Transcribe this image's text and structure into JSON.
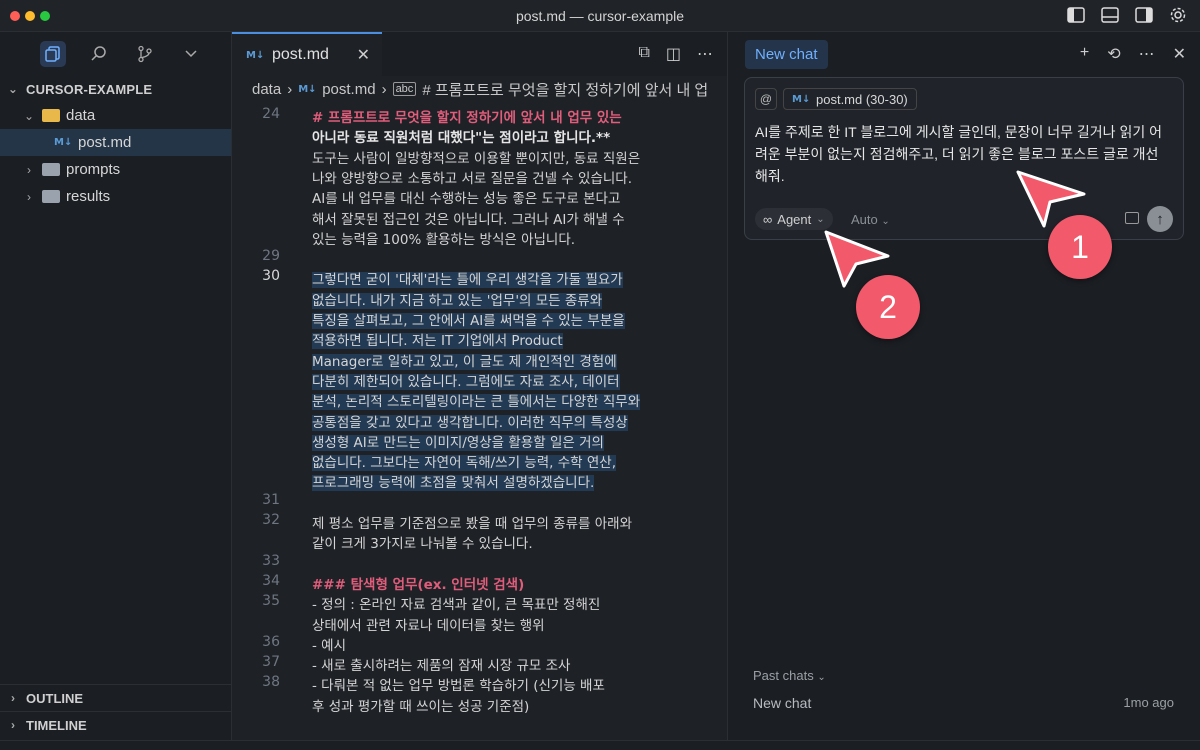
{
  "window": {
    "title": "post.md — cursor-example"
  },
  "colors": {
    "accent": "#4a8fe0",
    "heading": "#e05d7b",
    "callout": "#f25a6b",
    "selection": "#233a55"
  },
  "explorer": {
    "root": "CURSOR-EXAMPLE",
    "items": [
      {
        "label": "data",
        "type": "folder-open"
      },
      {
        "label": "post.md",
        "type": "markdown-file"
      },
      {
        "label": "prompts",
        "type": "folder"
      },
      {
        "label": "results",
        "type": "folder"
      }
    ],
    "outline": "OUTLINE",
    "timeline": "TIMELINE"
  },
  "editor": {
    "tab_label": "post.md",
    "breadcrumb": {
      "folder": "data",
      "file": "post.md",
      "symbol": "# 프롬프트로 무엇을 할지 정하기에 앞서 내 업"
    },
    "lines": [
      {
        "num": "24",
        "text": "# 프롬프트로 무엇을 할지 정하기에 앞서 내 업무 있는",
        "style": "heading"
      },
      {
        "num": "",
        "text": "아니라 동료 직원처럼 대했다\"는 점이라고 합니다.**",
        "style": "bold"
      },
      {
        "num": "",
        "text": "도구는 사람이 일방향적으로 이용할 뿐이지만, 동료 직원은",
        "style": "normal"
      },
      {
        "num": "",
        "text": "나와 양방향으로 소통하고 서로 질문을 건넬 수 있습니다.",
        "style": "normal"
      },
      {
        "num": "",
        "text": "AI를 내 업무를 대신 수행하는 성능 좋은 도구로 본다고",
        "style": "normal"
      },
      {
        "num": "",
        "text": "해서 잘못된 접근인 것은 아닙니다. 그러나 AI가 해낼 수",
        "style": "normal"
      },
      {
        "num": "",
        "text": "있는 능력을 100% 활용하는 방식은 아닙니다.",
        "style": "normal"
      },
      {
        "num": "29",
        "text": "",
        "style": "normal"
      },
      {
        "num": "30",
        "text": "그렇다면 굳이 '대체'라는 틀에 우리 생각을 가둘 필요가",
        "style": "sel"
      },
      {
        "num": "",
        "text": "없습니다. 내가 지금 하고 있는 '업무'의 모든 종류와",
        "style": "sel"
      },
      {
        "num": "",
        "text": "특징을 살펴보고, 그 안에서 AI를 써먹을 수 있는 부분을",
        "style": "sel"
      },
      {
        "num": "",
        "text": "적용하면 됩니다. 저는 IT 기업에서 Product",
        "style": "sel"
      },
      {
        "num": "",
        "text": "Manager로 일하고 있고, 이 글도 제 개인적인 경험에",
        "style": "sel"
      },
      {
        "num": "",
        "text": "다분히 제한되어 있습니다. 그럼에도 자료 조사, 데이터",
        "style": "sel"
      },
      {
        "num": "",
        "text": "분석, 논리적 스토리텔링이라는 큰 틀에서는 다양한 직무와",
        "style": "sel"
      },
      {
        "num": "",
        "text": "공통점을 갖고 있다고 생각합니다. 이러한 직무의 특성상",
        "style": "sel"
      },
      {
        "num": "",
        "text": "생성형 AI로 만드는 이미지/영상을 활용할 일은 거의",
        "style": "sel"
      },
      {
        "num": "",
        "text": "없습니다. 그보다는 자연어 독해/쓰기 능력, 수학 연산,",
        "style": "sel"
      },
      {
        "num": "",
        "text": "프로그래밍 능력에 초점을 맞춰서 설명하겠습니다.",
        "style": "sel"
      },
      {
        "num": "31",
        "text": "",
        "style": "normal"
      },
      {
        "num": "32",
        "text": "제 평소 업무를 기준점으로 봤을 때 업무의 종류를 아래와",
        "style": "normal"
      },
      {
        "num": "",
        "text": "같이 크게 3가지로 나눠볼 수 있습니다.",
        "style": "normal"
      },
      {
        "num": "33",
        "text": "",
        "style": "normal"
      },
      {
        "num": "34",
        "text": "### 탐색형 업무(ex. 인터넷 검색)",
        "style": "heading"
      },
      {
        "num": "35",
        "text": "- 정의 : 온라인 자료 검색과 같이, 큰 목표만 정해진",
        "style": "normal"
      },
      {
        "num": "",
        "text": "상태에서 관련 자료나 데이터를 찾는 행위",
        "style": "normal"
      },
      {
        "num": "36",
        "text": "- 예시",
        "style": "normal"
      },
      {
        "num": "37",
        "text": "    - 새로 출시하려는 제품의 잠재 시장 규모 조사",
        "style": "normal"
      },
      {
        "num": "38",
        "text": "    - 다뤄본 적 없는 업무 방법론 학습하기 (신기능 배포",
        "style": "normal"
      },
      {
        "num": "",
        "text": "후 성과 평가할 때 쓰이는 성공 기준점)",
        "style": "normal"
      }
    ]
  },
  "chat": {
    "tab_label": "New chat",
    "context_chip": "post.md (30-30)",
    "prompt": "AI를 주제로 한 IT 블로그에 게시할 글인데, 문장이 너무 길거나 읽기 어려운 부분이 없는지 점검해주고, 더 읽기 좋은 블로그 포스트 글로 개선해줘.",
    "mode": "Agent",
    "model": "Auto",
    "past_chats_label": "Past chats",
    "past_chats": [
      {
        "title": "New chat",
        "time": "1mo ago"
      }
    ]
  },
  "callouts": [
    "1",
    "2"
  ]
}
